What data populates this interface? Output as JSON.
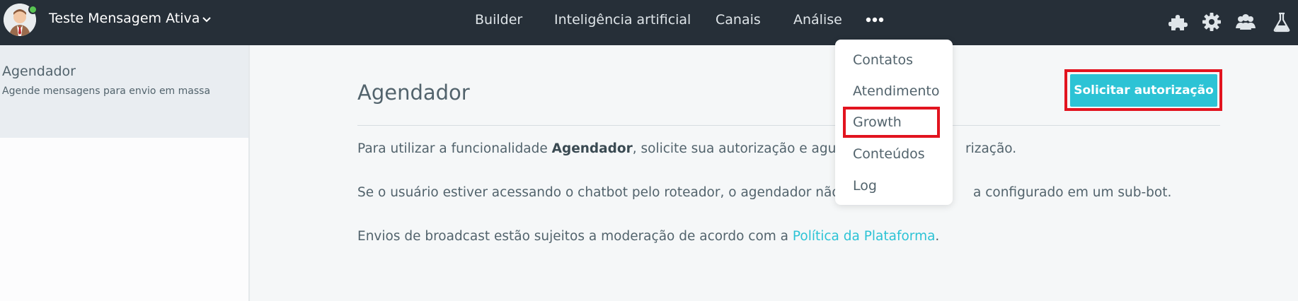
{
  "header": {
    "bot_name": "Teste Mensagem Ativa",
    "nav": [
      "Builder",
      "Inteligência artificial",
      "Canais",
      "Análise"
    ],
    "more_icon": "more-dots-icon",
    "right_icons": [
      "puzzle-icon",
      "gear-icon",
      "team-icon",
      "flask-icon"
    ],
    "colors": {
      "background": "#262f38",
      "online_dot": "#58c552"
    }
  },
  "sidebar": {
    "items": [
      {
        "title": "Agendador",
        "subtitle": "Agende mensagens para envio em massa",
        "active": true
      }
    ]
  },
  "main": {
    "title": "Agendador",
    "cta_label": "Solicitar autorização",
    "paragraph1": {
      "before": "Para utilizar a funcionalidade ",
      "bold": "Agendador",
      "after": ", solicite sua autorização e aguarde",
      "tail": "rização."
    },
    "paragraph2": {
      "before": "Se o usuário estiver acessando o chatbot pelo roteador, o agendador não fun",
      "after": "a configurado em um sub-bot."
    },
    "paragraph3": {
      "before": "Envios de broadcast estão sujeitos a moderação de acordo com a ",
      "link": "Política da Plataforma",
      "after": "."
    }
  },
  "dropdown": {
    "items": [
      "Contatos",
      "Atendimento",
      "Growth",
      "Conteúdos",
      "Log"
    ],
    "highlighted": "Growth"
  },
  "colors": {
    "accent": "#2cc3d5",
    "highlight_border": "#e2141f",
    "text": "#52636c"
  }
}
